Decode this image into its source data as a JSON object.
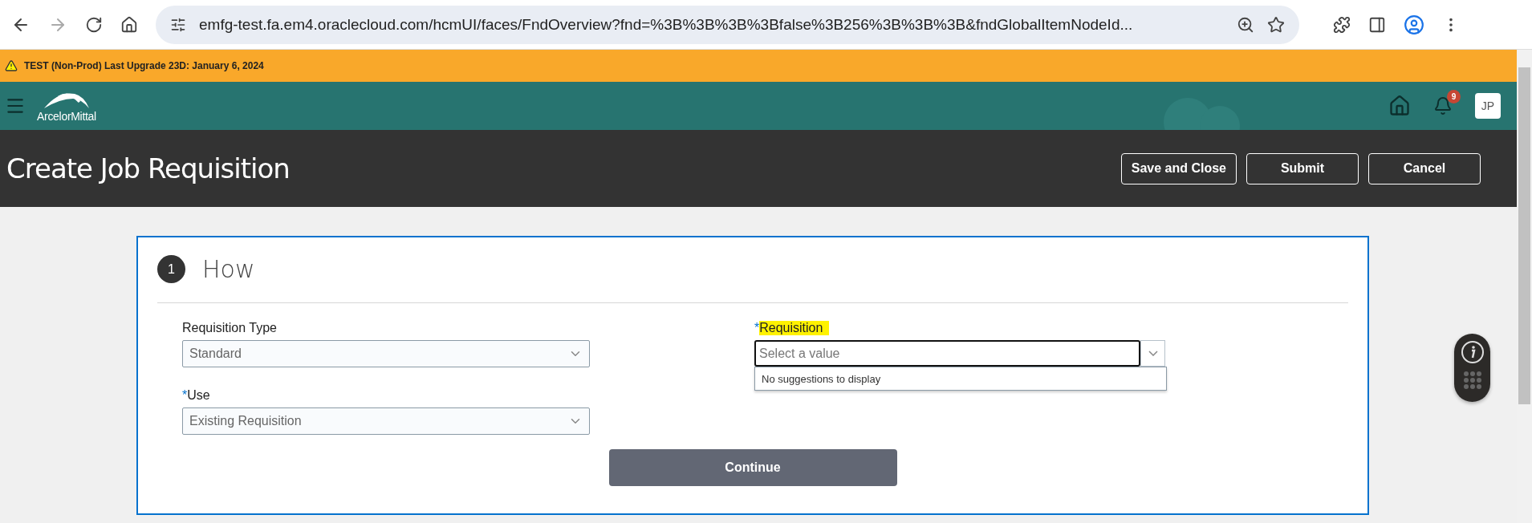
{
  "browser": {
    "url": "emfg-test.fa.em4.oraclecloud.com/hcmUI/faces/FndOverview?fnd=%3B%3B%3B%3Bfalse%3B256%3B%3B%3B&fndGlobalItemNodeId..."
  },
  "banner": {
    "text": "TEST (Non-Prod) Last Upgrade 23D: January 6, 2024"
  },
  "header": {
    "logo": "ArcelorMittal",
    "notification_count": "9",
    "avatar": "JP"
  },
  "page": {
    "title": "Create Job Requisition",
    "buttons": [
      "Save and Close",
      "Submit",
      "Cancel"
    ]
  },
  "step": {
    "number": "1",
    "title": "How"
  },
  "fields": [
    {
      "label": "Requisition Type",
      "value": "Standard",
      "focused": false
    },
    {
      "required_mark": "*",
      "label": "Use",
      "value": "Existing Requisition",
      "focused": false
    }
  ],
  "requisition_field": {
    "required_mark": "*",
    "label": "Requisition",
    "highlighted": true,
    "placeholder": "Select a value",
    "focused": true,
    "suggestion": "No suggestions to display"
  },
  "continue_button": "Continue"
}
